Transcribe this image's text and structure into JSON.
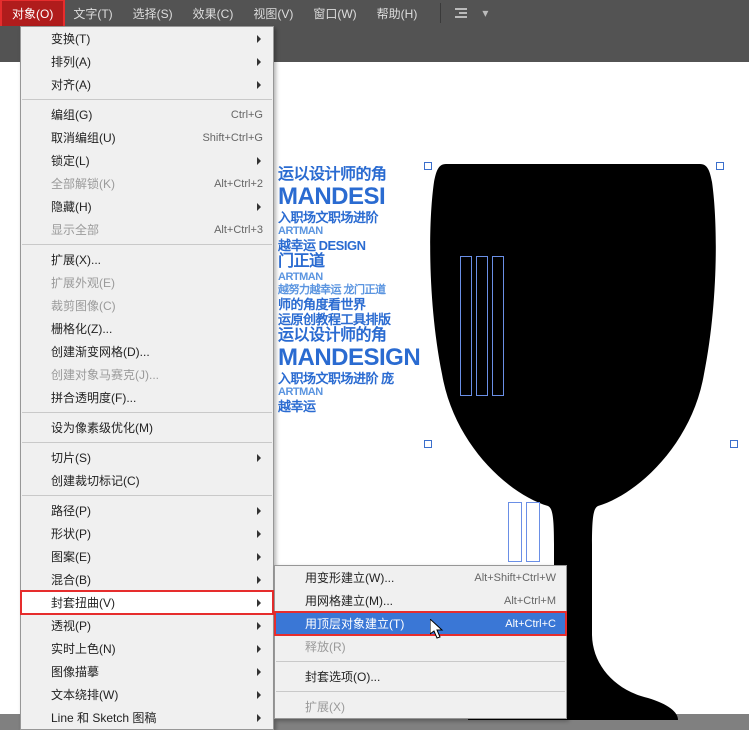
{
  "menubar": {
    "object": "对象(O)",
    "type": "文字(T)",
    "select": "选择(S)",
    "effect": "效果(C)",
    "view": "视图(V)",
    "window": "窗口(W)",
    "help": "帮助(H)"
  },
  "menu": {
    "transform": "变换(T)",
    "arrange": "排列(A)",
    "align": "对齐(A)",
    "group": "编组(G)",
    "group_sc": "Ctrl+G",
    "ungroup": "取消编组(U)",
    "ungroup_sc": "Shift+Ctrl+G",
    "lock": "锁定(L)",
    "unlock_all": "全部解锁(K)",
    "unlock_all_sc": "Alt+Ctrl+2",
    "hide": "隐藏(H)",
    "show_all": "显示全部",
    "show_all_sc": "Alt+Ctrl+3",
    "expand": "扩展(X)...",
    "expand_appearance": "扩展外观(E)",
    "crop_image": "裁剪图像(C)",
    "rasterize": "栅格化(Z)...",
    "gradient_mesh": "创建渐变网格(D)...",
    "object_mosaic": "创建对象马赛克(J)...",
    "flatten_trans": "拼合透明度(F)...",
    "pixel_perfect": "设为像素级优化(M)",
    "slice": "切片(S)",
    "trim_marks": "创建裁切标记(C)",
    "path": "路径(P)",
    "shape": "形状(P)",
    "pattern": "图案(E)",
    "blend": "混合(B)",
    "envelope": "封套扭曲(V)",
    "perspective": "透视(P)",
    "live_paint": "实时上色(N)",
    "image_trace": "图像描摹",
    "text_wrap": "文本绕排(W)",
    "line_sketch": "Line 和 Sketch 图稿"
  },
  "submenu": {
    "make_warp": "用变形建立(W)...",
    "make_warp_sc": "Alt+Shift+Ctrl+W",
    "make_mesh": "用网格建立(M)...",
    "make_mesh_sc": "Alt+Ctrl+M",
    "make_top": "用顶层对象建立(T)",
    "make_top_sc": "Alt+Ctrl+C",
    "release": "释放(R)",
    "options": "封套选项(O)...",
    "expand": "扩展(X)"
  },
  "typo": {
    "l1": "运以设计师的角",
    "l2": "MANDESI",
    "l3": "入职场文职场进阶",
    "l4": "越幸运 DESIGN",
    "l5": "门正道",
    "l6": "越努力越幸运 龙门正道",
    "l7": "师的角度看世界",
    "l8": "运原创教程工具排版",
    "l9": "运以设计师的角",
    "l10": "MANDESIGN",
    "l11": "入职场文职场进阶 庞",
    "l12": "越幸运",
    "artman": "ARTMAN"
  }
}
